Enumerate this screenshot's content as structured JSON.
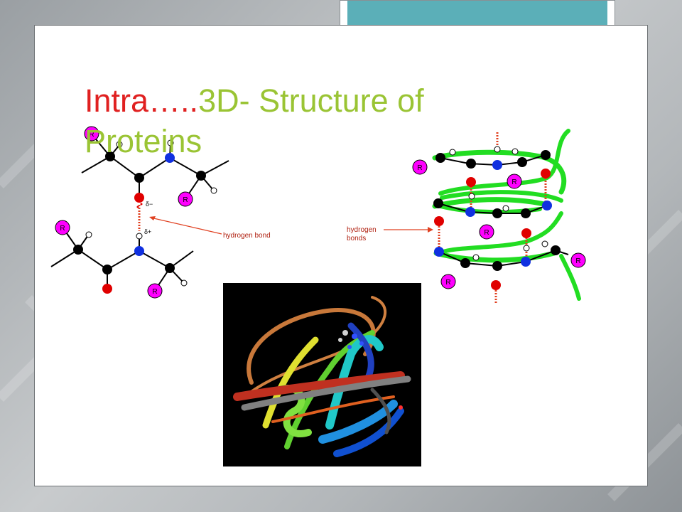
{
  "slide": {
    "title_part1": "Intra…..",
    "title_part2": "3D- Structure of Proteins"
  },
  "left_diagram": {
    "atom_label": "R",
    "delta_minus": "δ−",
    "delta_plus": "δ+",
    "bond_label": "hydrogen bond"
  },
  "right_diagram": {
    "atom_label": "R",
    "bonds_label_line1": "hydrogen",
    "bonds_label_line2": "bonds"
  },
  "colors": {
    "title_red": "#e02020",
    "title_green": "#9ac434",
    "accent_teal": "#5bafb8",
    "atom_black": "#000000",
    "atom_red": "#e00000",
    "atom_blue": "#1030e0",
    "atom_magenta": "#ff00ff",
    "helix_green": "#22dd22",
    "arrow_red": "#e04020"
  }
}
